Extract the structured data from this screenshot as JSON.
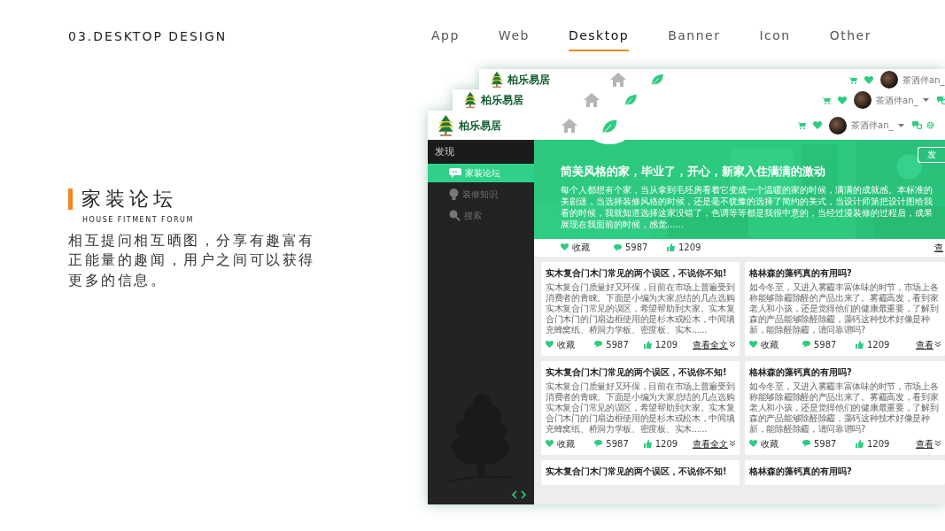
{
  "slide": {
    "section_code": "03.DESKTOP DESIGN",
    "tabs": [
      {
        "label": "App",
        "selected": false
      },
      {
        "label": "Web",
        "selected": false
      },
      {
        "label": "Desktop",
        "selected": true
      },
      {
        "label": "Banner",
        "selected": false
      },
      {
        "label": "Icon",
        "selected": false
      },
      {
        "label": "Other",
        "selected": false
      }
    ]
  },
  "feature": {
    "title": "家装论坛",
    "subtitle": "HOUSE FITMENT FORUM",
    "description": "相互提问相互晒图，分享有趣富有正能量的趣闻，用户之间可以获得更多的信息。"
  },
  "back_windows": [
    {
      "brand": "柏乐易居",
      "user": "茶酒伴an_"
    },
    {
      "brand": "柏乐易居",
      "user": "茶酒伴an_"
    }
  ],
  "app": {
    "brand": "柏乐易居",
    "user": "茶酒伴an_",
    "sidebar": {
      "heading": "发现",
      "items": [
        {
          "label": "家装论坛",
          "kind": "chat",
          "selected": true
        },
        {
          "label": "装修知识",
          "kind": "bulb",
          "selected": false
        },
        {
          "label": "搜索",
          "kind": "search",
          "selected": false
        }
      ]
    },
    "banner": {
      "button": "发",
      "title": "简美风格的家，毕业了，开心，新家入住满满的激动",
      "text": "每个人都想有个家，当从拿到毛坯房看着它变成一个温暖的家的时候，满满的成就感。本标准的美剧迷，当选择装修风格的时候，还是毫不犹豫的选择了简约的美式，当设计师第把设计图给我看的时候，我就知道选择这家没错了，色调等等都是我很中意的，当经过漫装修的过程后，成果展现在我面前的时候，感觉......"
    },
    "banner_stats": {
      "favorite": "收藏",
      "comments": "5987",
      "likes": "1209",
      "more": "查"
    },
    "cards": [
      {
        "title": "实木复合门木门常见的两个误区，不说你不知!",
        "text": "实木复合门质量好又环保，目前在市场上普遍受到消费者的青睐。下面是小编为大家总结的几点选购实木复合门常见的误区，希望帮助到大家。实木复合门木门的门扇边框使用的是杉木或松木，中间填充蜂窝纸、桥洞力学板、密度板、实木......",
        "favorite": "收藏",
        "comments": "5987",
        "likes": "1209",
        "more": "查看全文"
      },
      {
        "title": "格林森的藻钙真的有用吗?",
        "text": "如今冬至，又进入雾霾丰富体味的时节，市场上各称能够除霾除醛的产品出来了。雾霾高发，看到家老人和小孩，还是觉得他们的健康最重要，了解到森的产品能够除醛除霾，藻钙这种技术好像是种新，能除醛除霾，请问靠谱吗?",
        "favorite": "收藏",
        "comments": "5987",
        "likes": "1209",
        "more": "查看"
      },
      {
        "title": "实木复合门木门常见的两个误区，不说你不知!",
        "text": "实木复合门质量好又环保，目前在市场上普遍受到消费者的青睐。下面是小编为大家总结的几点选购实木复合门常见的误区，希望帮助到大家。实木复合门木门的门扇边框使用的是杉木或松木，中间填充蜂窝纸、桥洞力学板、密度板、实木......",
        "favorite": "收藏",
        "comments": "5987",
        "likes": "1209",
        "more": "查看全文"
      },
      {
        "title": "格林森的藻钙真的有用吗?",
        "text": "如今冬至，又进入雾霾丰富体味的时节，市场上各称能够除霾除醛的产品出来了。雾霾高发，看到家老人和小孩，还是觉得他们的健康最重要，了解到森的产品能够除醛除霾，藻钙这种技术好像是种新，能除醛除霾，请问靠谱吗?",
        "favorite": "收藏",
        "comments": "5987",
        "likes": "1209",
        "more": "查看"
      },
      {
        "title": "实木复合门木门常见的两个误区，不说你不知!"
      },
      {
        "title": "格林森的藻钙真的有用吗?"
      }
    ]
  }
}
